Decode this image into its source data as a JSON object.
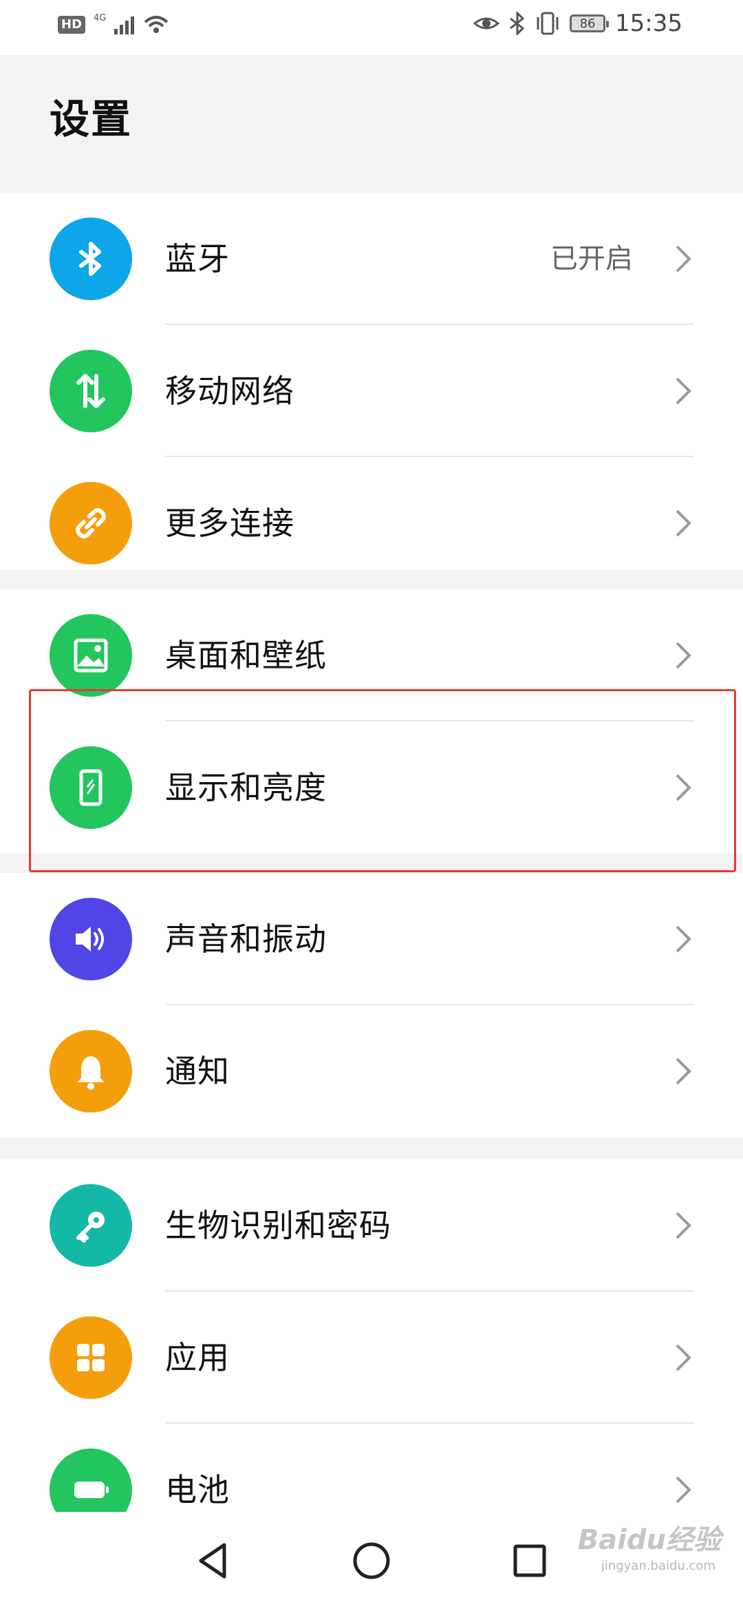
{
  "status_bar": {
    "hd": "HD",
    "network": "4G",
    "battery": "86",
    "time": "15:35"
  },
  "page": {
    "title": "设置"
  },
  "settings": {
    "bluetooth": {
      "label": "蓝牙",
      "value": "已开启",
      "icon": "bluetooth-icon",
      "color": "#0ea5e9"
    },
    "mobile_network": {
      "label": "移动网络",
      "icon": "data-transfer-icon",
      "color": "#22c55e"
    },
    "more_connections": {
      "label": "更多连接",
      "icon": "link-icon",
      "color": "#f59e0b"
    },
    "desktop_wallpaper": {
      "label": "桌面和壁纸",
      "icon": "image-icon",
      "color": "#22c55e"
    },
    "display_brightness": {
      "label": "显示和亮度",
      "icon": "phone-display-icon",
      "color": "#22c55e"
    },
    "sound_vibration": {
      "label": "声音和振动",
      "icon": "speaker-icon",
      "color": "#4f46e5"
    },
    "notifications": {
      "label": "通知",
      "icon": "bell-icon",
      "color": "#f59e0b"
    },
    "biometrics_password": {
      "label": "生物识别和密码",
      "icon": "key-icon",
      "color": "#14b8a6"
    },
    "apps": {
      "label": "应用",
      "icon": "apps-grid-icon",
      "color": "#f59e0b"
    },
    "battery": {
      "label": "电池",
      "icon": "battery-icon",
      "color": "#22c55e"
    }
  },
  "watermark": {
    "text": "Baidu经验",
    "sub": "jingyan.baidu.com"
  }
}
